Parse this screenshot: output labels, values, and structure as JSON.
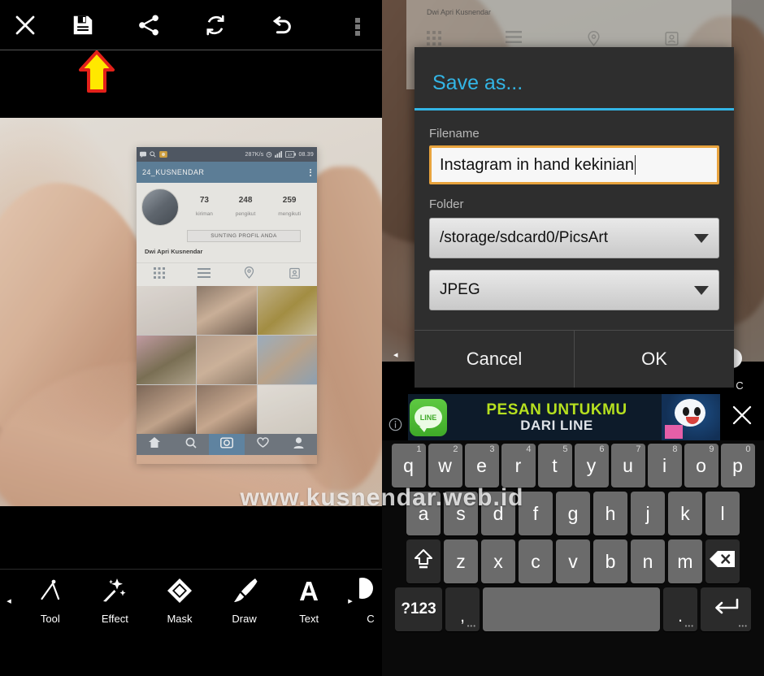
{
  "left_panel": {
    "top_toolbar": {
      "buttons": [
        {
          "name": "close",
          "icon": "close-icon",
          "label": "Close"
        },
        {
          "name": "save",
          "icon": "save-icon",
          "label": "Save"
        },
        {
          "name": "share",
          "icon": "share-icon",
          "label": "Share"
        },
        {
          "name": "redo",
          "icon": "refresh-icon",
          "label": "Redo"
        },
        {
          "name": "undo",
          "icon": "undo-icon",
          "label": "Undo"
        },
        {
          "name": "overflow",
          "icon": "overflow-menu-icon",
          "label": "More options"
        }
      ]
    },
    "pointer": {
      "icon": "up-arrow-annotation",
      "fill": "#FFE800",
      "stroke": "#E32119",
      "points_to": "save-button"
    },
    "photo": {
      "phone_screenshot": {
        "status_bar": {
          "speed": "287K/s",
          "time": "08.39",
          "battery": "17"
        },
        "action_bar": {
          "username": "24_KUSNENDAR"
        },
        "stats": [
          {
            "value": "73",
            "label": "kiriman"
          },
          {
            "value": "248",
            "label": "pengikut"
          },
          {
            "value": "259",
            "label": "mengikuti"
          }
        ],
        "edit_profile_button": "SUNTING PROFIL ANDA",
        "display_name": "Dwi Apri Kusnendar",
        "tabs": [
          "grid-icon",
          "list-icon",
          "location-icon",
          "tagged-icon"
        ],
        "bottom_nav": [
          "home-icon",
          "search-icon",
          "camera-icon",
          "heart-icon",
          "person-icon"
        ]
      }
    },
    "bottom_tools": {
      "prev_arrow": "◂",
      "next_arrow": "▸",
      "items": [
        {
          "label": "Tool",
          "icon": "compass-tool-icon"
        },
        {
          "label": "Effect",
          "icon": "magic-wand-icon"
        },
        {
          "label": "Mask",
          "icon": "diamond-mask-icon"
        },
        {
          "label": "Draw",
          "icon": "paintbrush-icon"
        },
        {
          "label": "Text",
          "icon": "text-a-icon"
        }
      ],
      "clipped_item": {
        "label": "C",
        "icon": "camera-partial-icon"
      }
    }
  },
  "right_panel": {
    "background": {
      "display_name": "Dwi Apri Kusnendar"
    },
    "dialog": {
      "title": "Save as...",
      "accent_color": "#33b5e5",
      "filename_label": "Filename",
      "filename_value": "Instagram in hand kekinian",
      "filename_border_color": "#e8a33d",
      "folder_label": "Folder",
      "folder_value": "/storage/sdcard0/PicsArt",
      "format_value": "JPEG",
      "cancel_label": "Cancel",
      "ok_label": "OK"
    },
    "ad_banner": {
      "info_icon": "info-icon",
      "logo_text": "LINE",
      "line1": "PESAN UNTUKMU",
      "line2": "DARI LINE",
      "close_icon": "close-icon"
    },
    "toolstrip": {
      "prev_arrow": "◂",
      "next_arrow": "▸",
      "clipped_label": "C"
    },
    "keyboard": {
      "row1": [
        {
          "key": "q",
          "num": "1"
        },
        {
          "key": "w",
          "num": "2"
        },
        {
          "key": "e",
          "num": "3"
        },
        {
          "key": "r",
          "num": "4"
        },
        {
          "key": "t",
          "num": "5"
        },
        {
          "key": "y",
          "num": "6"
        },
        {
          "key": "u",
          "num": "7"
        },
        {
          "key": "i",
          "num": "8"
        },
        {
          "key": "o",
          "num": "9"
        },
        {
          "key": "p",
          "num": "0"
        }
      ],
      "row2": [
        "a",
        "s",
        "d",
        "f",
        "g",
        "h",
        "j",
        "k",
        "l"
      ],
      "row3": [
        "z",
        "x",
        "c",
        "v",
        "b",
        "n",
        "m"
      ],
      "shift_icon": "shift-icon",
      "backspace_icon": "backspace-icon",
      "symbols_label": "?123",
      "comma_label": ",",
      "space_label": "",
      "period_label": ".",
      "enter_icon": "enter-icon"
    }
  },
  "watermark": {
    "text": "www.kusnendar.web.id"
  }
}
